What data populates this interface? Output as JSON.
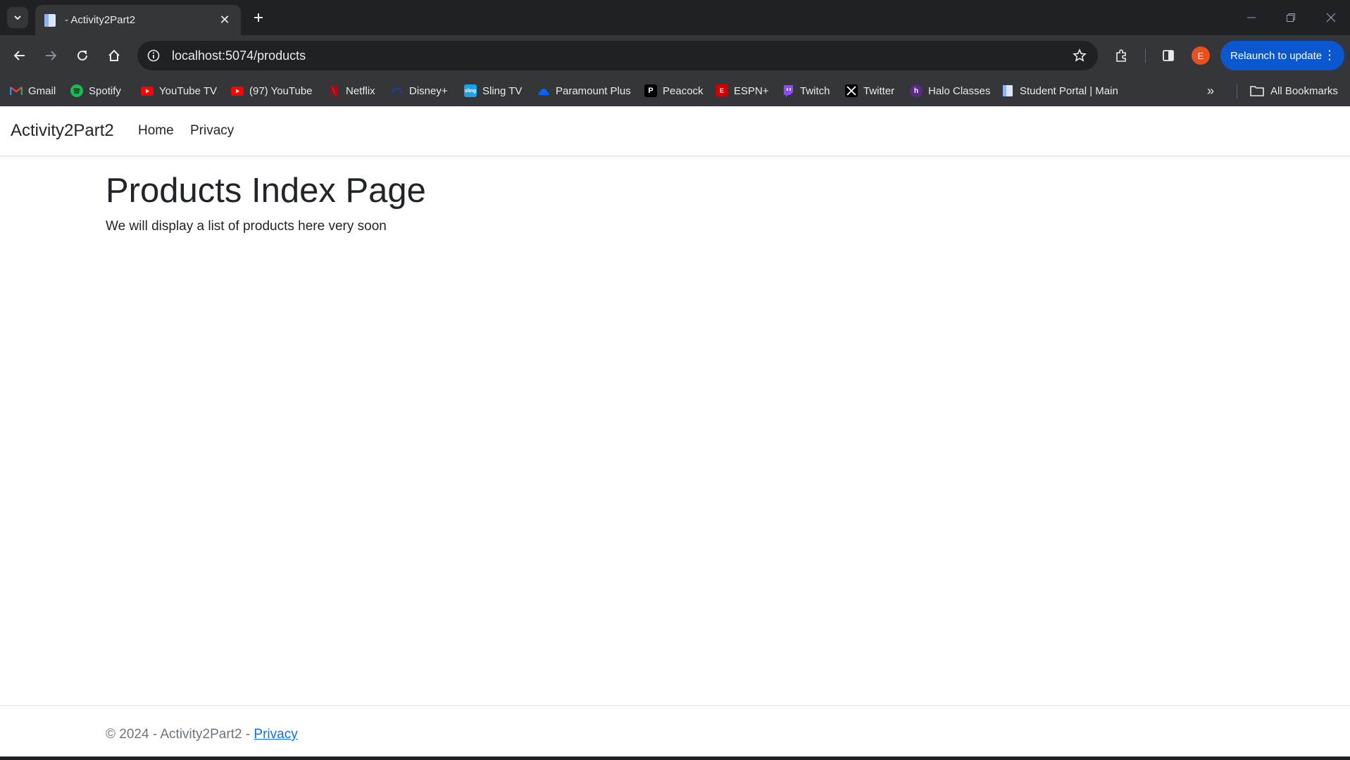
{
  "browser": {
    "tab": {
      "title": "- Activity2Part2",
      "close_icon": "close-icon"
    },
    "url": "localhost:5074/products",
    "relaunch_label": "Relaunch to update",
    "profile_initial": "E",
    "colors": {
      "chrome_dark": "#202124",
      "chrome": "#35363a",
      "relaunch": "#0b57d0",
      "profile": "#e8501f"
    }
  },
  "bookmarks": {
    "items": [
      {
        "label": "Gmail",
        "icon": "gmail-icon",
        "color": "#ea4335"
      },
      {
        "label": "Spotify",
        "icon": "spotify-icon",
        "color": "#1db954"
      },
      {
        "label": "YouTube TV",
        "icon": "youtube-tv-icon",
        "color": "#ff0000"
      },
      {
        "label": "(97) YouTube",
        "icon": "youtube-icon",
        "color": "#ff0000"
      },
      {
        "label": "Netflix",
        "icon": "netflix-icon",
        "color": "#e50914"
      },
      {
        "label": "Disney+",
        "icon": "disney-plus-icon",
        "color": "#1e3a8a"
      },
      {
        "label": "Sling TV",
        "icon": "sling-tv-icon",
        "color": "#1aa3e8"
      },
      {
        "label": "Paramount Plus",
        "icon": "paramount-plus-icon",
        "color": "#0064ff"
      },
      {
        "label": "Peacock",
        "icon": "peacock-icon",
        "color": "#000000"
      },
      {
        "label": "ESPN+",
        "icon": "espn-plus-icon",
        "color": "#cc0000"
      },
      {
        "label": "Twitch",
        "icon": "twitch-icon",
        "color": "#9146ff"
      },
      {
        "label": "Twitter",
        "icon": "x-icon",
        "color": "#000000"
      },
      {
        "label": "Halo Classes",
        "icon": "halo-icon",
        "color": "#5b2a86"
      },
      {
        "label": "Student Portal | Main",
        "icon": "page-icon",
        "color": "#dce6f5"
      }
    ],
    "all_label": "All Bookmarks"
  },
  "site": {
    "brand": "Activity2Part2",
    "nav": [
      "Home",
      "Privacy"
    ],
    "page_title": "Products Index Page",
    "page_desc": "We will display a list of products here very soon",
    "footer": {
      "text": "© 2024 - Activity2Part2 - ",
      "link": "Privacy"
    }
  }
}
